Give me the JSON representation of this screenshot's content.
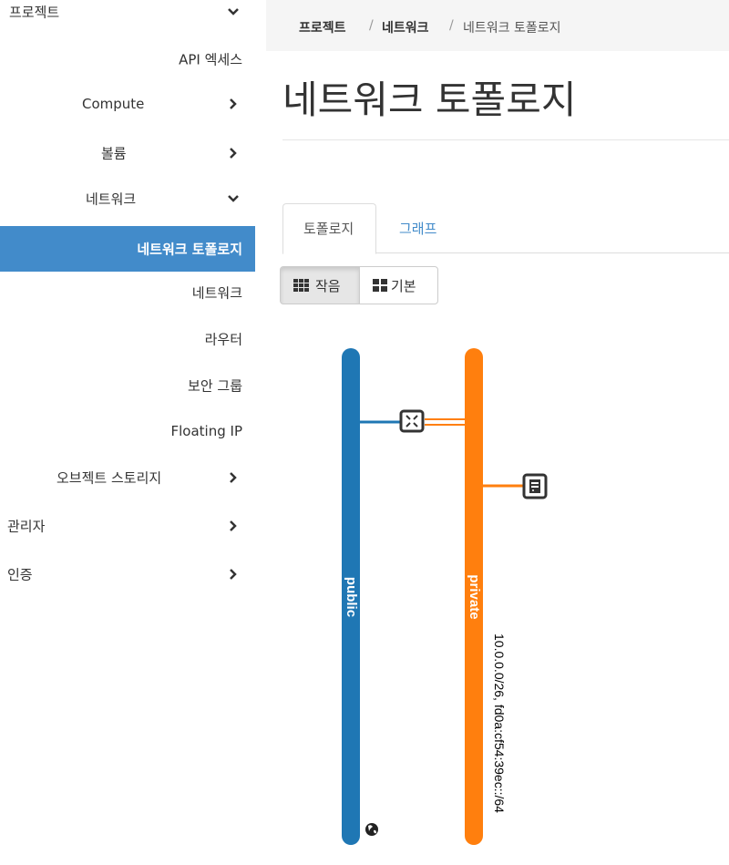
{
  "sidebar": {
    "project": "프로젝트",
    "api_access": "API 엑세스",
    "compute": "Compute",
    "volume": "볼륨",
    "network": "네트워크",
    "network_topology": "네트워크 토폴로지",
    "networks": "네트워크",
    "routers": "라우터",
    "security_groups": "보안 그룹",
    "floating_ip": "Floating IP",
    "object_storage": "오브젝트 스토리지",
    "admin": "관리자",
    "identity": "인증"
  },
  "breadcrumb": {
    "item1": "프로젝트",
    "sep": "/",
    "item2": "네트워크",
    "item3": "네트워크 토폴로지"
  },
  "page_title": "네트워크 토폴로지",
  "tabs": {
    "topology": "토폴로지",
    "graph": "그래프"
  },
  "view_toggle": {
    "small": "작음",
    "normal": "기본",
    "selected": "small"
  },
  "topology": {
    "networks": [
      {
        "name": "public",
        "color": "#1f77b4",
        "cidr": ""
      },
      {
        "name": "private",
        "color": "#ff7f0e",
        "cidr": "10.0.0.0/26, fd0a:cf54:39ec::/64"
      }
    ],
    "router_icon": "router-icon",
    "instance_icon": "server-icon",
    "external_icon": "globe-icon"
  }
}
